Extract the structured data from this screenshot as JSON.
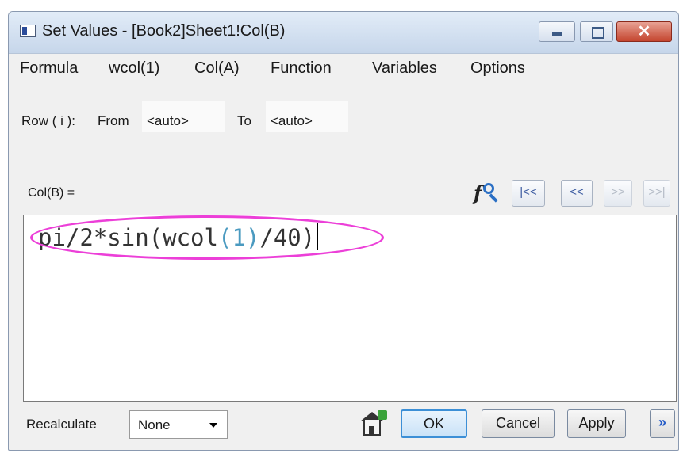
{
  "window": {
    "title": "Set Values - [Book2]Sheet1!Col(B)",
    "close_glyph": "✕"
  },
  "menu": [
    "Formula",
    "wcol(1)",
    "Col(A)",
    "Function",
    "Variables",
    "Options"
  ],
  "row": {
    "label": "Row ( i ):",
    "from_label": "From",
    "from_value": "<auto>",
    "to_label": "To",
    "to_value": "<auto>"
  },
  "editor": {
    "col_label": "Col(B) =",
    "formula_a": "pi/2*sin(wcol",
    "formula_b": "(1)",
    "formula_c": "/40)",
    "nav_buttons": [
      "|<<",
      "<<",
      ">>",
      ">>|"
    ]
  },
  "footer": {
    "recalculate_label": "Recalculate",
    "recalculate_value": "None",
    "ok_label": "OK",
    "cancel_label": "Cancel",
    "apply_label": "Apply",
    "expand_glyph": "»"
  },
  "colors": {
    "highlight_ellipse": "#ec3fd8",
    "formula_highlight": "#4a9ac0"
  }
}
